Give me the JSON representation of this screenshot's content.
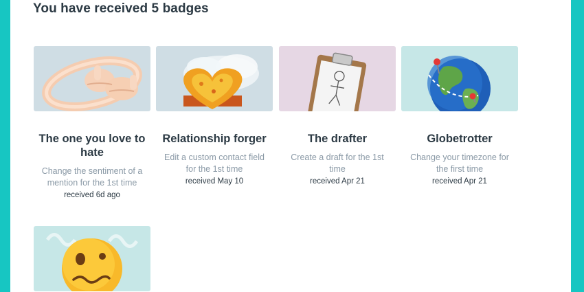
{
  "page": {
    "heading": "You have received 5 badges"
  },
  "badges": [
    {
      "title": "The one you love to hate",
      "description": "Change the sentiment of a mention for the 1st time",
      "received": "received 6d ago",
      "icon": "ring-thumbs-icon",
      "bg_color": "#cfdde4"
    },
    {
      "title": "Relationship forger",
      "description": "Edit a custom contact field for the 1st time",
      "received": "received May 10",
      "icon": "fire-heart-icon",
      "bg_color": "#cfdde4"
    },
    {
      "title": "The drafter",
      "description": "Create a draft for the 1st time",
      "received": "received Apr 21",
      "icon": "clipboard-icon",
      "bg_color": "#e6d7e4"
    },
    {
      "title": "Globetrotter",
      "description": "Change your timezone for the first time",
      "received": "received Apr 21",
      "icon": "globe-icon",
      "bg_color": "#c6e7e7"
    },
    {
      "title": "",
      "description": "",
      "received": "",
      "icon": "woozy-face-icon",
      "bg_color": "#c6e7e7"
    }
  ]
}
